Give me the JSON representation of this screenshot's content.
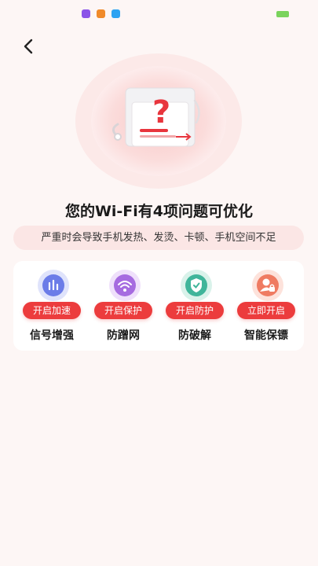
{
  "status_bar": {
    "notification_icons": [
      {
        "name": "app-notification-icon",
        "color": "#8b54e8"
      },
      {
        "name": "mi-notification-icon",
        "color": "#f08a2a"
      },
      {
        "name": "message-notification-icon",
        "color": "#2ea3f2"
      }
    ],
    "battery_color": "#7ad35c"
  },
  "header": {
    "back_icon": "chevron-left-icon"
  },
  "hero": {
    "icon": "wifi-problem-illustration",
    "accent": "#e8353d"
  },
  "headline": "您的Wi-Fi有4项问题可优化",
  "warning": "严重时会导致手机发热、发烫、卡顿、手机空间不足",
  "features": [
    {
      "icon": "signal-boost-icon",
      "button": "开启加速",
      "label": "信号增强",
      "color": "#6b7ce8"
    },
    {
      "icon": "anti-freeload-icon",
      "button": "开启保护",
      "label": "防蹭网",
      "color": "#a66be0"
    },
    {
      "icon": "anti-crack-shield-icon",
      "button": "开启防护",
      "label": "防破解",
      "color": "#3fb59a"
    },
    {
      "icon": "smart-guard-icon",
      "button": "立即开启",
      "label": "智能保镖",
      "color": "#ef7b62"
    }
  ],
  "colors": {
    "accent": "#ec3c3d",
    "background": "#fdf6f5"
  }
}
